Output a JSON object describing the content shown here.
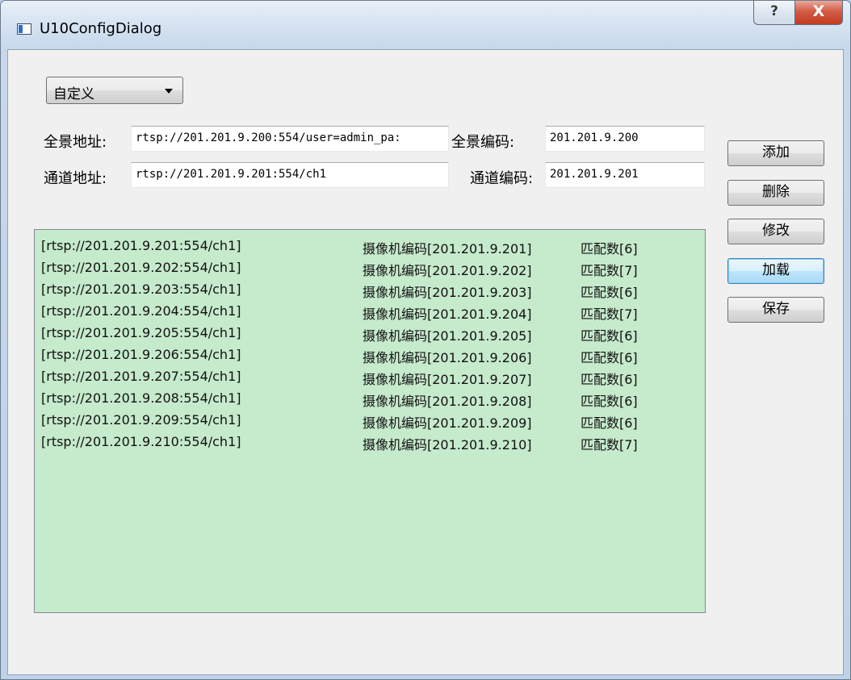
{
  "window": {
    "title": "U10ConfigDialog",
    "help_symbol": "?",
    "close_symbol": "X"
  },
  "mode_combo": {
    "selected": "自定义"
  },
  "form": {
    "panorama_address_label": "全景地址:",
    "panorama_address_value": "rtsp://201.201.9.200:554/user=admin_pa:",
    "panorama_code_label": "全景编码:",
    "panorama_code_value": "201.201.9.200",
    "channel_address_label": "通道地址:",
    "channel_address_value": "rtsp://201.201.9.201:554/ch1",
    "channel_code_label": "通道编码:",
    "channel_code_value": "201.201.9.201"
  },
  "buttons": {
    "add": "添加",
    "delete": "删除",
    "modify": "修改",
    "load": "加载",
    "save": "保存"
  },
  "list": {
    "rows": [
      {
        "url": "[rtsp://201.201.9.201:554/ch1]",
        "code": "摄像机编码[201.201.9.201]",
        "match": "匹配数[6]"
      },
      {
        "url": "[rtsp://201.201.9.202:554/ch1]",
        "code": "摄像机编码[201.201.9.202]",
        "match": "匹配数[7]"
      },
      {
        "url": "[rtsp://201.201.9.203:554/ch1]",
        "code": "摄像机编码[201.201.9.203]",
        "match": "匹配数[6]"
      },
      {
        "url": "[rtsp://201.201.9.204:554/ch1]",
        "code": "摄像机编码[201.201.9.204]",
        "match": "匹配数[7]"
      },
      {
        "url": "[rtsp://201.201.9.205:554/ch1]",
        "code": "摄像机编码[201.201.9.205]",
        "match": "匹配数[6]"
      },
      {
        "url": "[rtsp://201.201.9.206:554/ch1]",
        "code": "摄像机编码[201.201.9.206]",
        "match": "匹配数[6]"
      },
      {
        "url": "[rtsp://201.201.9.207:554/ch1]",
        "code": "摄像机编码[201.201.9.207]",
        "match": "匹配数[6]"
      },
      {
        "url": "[rtsp://201.201.9.208:554/ch1]",
        "code": "摄像机编码[201.201.9.208]",
        "match": "匹配数[6]"
      },
      {
        "url": "[rtsp://201.201.9.209:554/ch1]",
        "code": "摄像机编码[201.201.9.209]",
        "match": "匹配数[6]"
      },
      {
        "url": "[rtsp://201.201.9.210:554/ch1]",
        "code": "摄像机编码[201.201.9.210]",
        "match": "匹配数[7]"
      }
    ]
  },
  "colors": {
    "list_background": "#c6eacc",
    "dialog_background": "#f0f0f0",
    "close_button": "#c23a20"
  }
}
